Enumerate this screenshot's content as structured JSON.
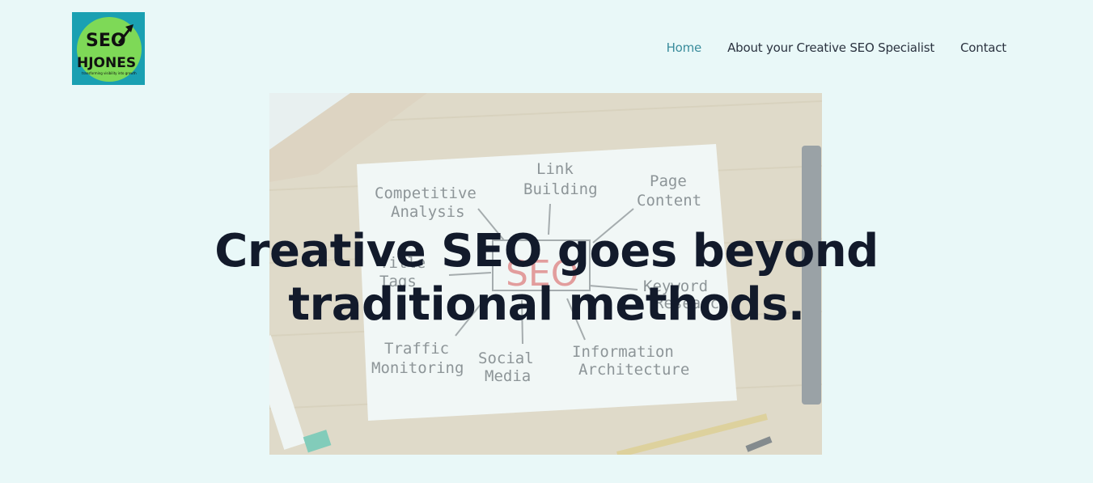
{
  "logo": {
    "line1": "SEO",
    "line2": "HJONES",
    "tagline": "transforming visibility into growth",
    "icon": "arrow-up-right-icon"
  },
  "nav": {
    "items": [
      {
        "label": "Home",
        "active": true
      },
      {
        "label": "About your Creative SEO Specialist",
        "active": false
      },
      {
        "label": "Contact",
        "active": false
      }
    ]
  },
  "hero": {
    "title": "Creative SEO goes beyond traditional methods.",
    "image": {
      "center_label": "SEO",
      "labels": {
        "competitive": [
          "Competitive",
          "Analysis"
        ],
        "link": [
          "Link",
          "Building"
        ],
        "page": [
          "Page",
          "Content"
        ],
        "title_tags": [
          "Title",
          "Tags"
        ],
        "keyword": [
          "Keyword",
          "Research"
        ],
        "traffic": [
          "Traffic",
          "Monitoring"
        ],
        "social": [
          "Social",
          "Media"
        ],
        "info": [
          "Information",
          "Architecture"
        ]
      }
    }
  },
  "colors": {
    "background": "#e9f8f8",
    "nav_active": "#3a8c9c",
    "title": "#121a2b",
    "logo_bg": "#1aa0b2",
    "logo_circle": "#7ed957"
  }
}
